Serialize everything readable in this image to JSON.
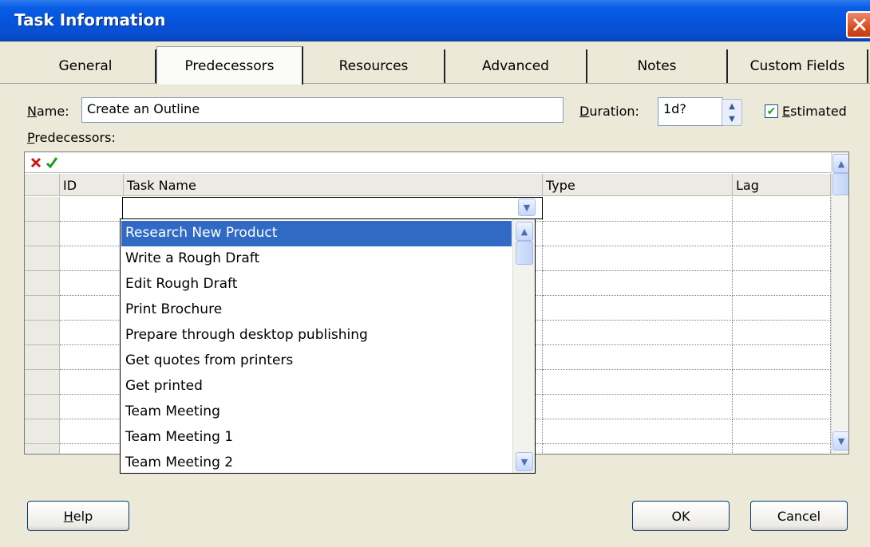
{
  "window": {
    "title": "Task Information"
  },
  "tabs": [
    {
      "label": "General"
    },
    {
      "label": "Predecessors"
    },
    {
      "label": "Resources"
    },
    {
      "label": "Advanced"
    },
    {
      "label": "Notes"
    },
    {
      "label": "Custom Fields"
    }
  ],
  "form": {
    "name_label": "ame:",
    "name_label_mnemonic": "N",
    "name_value": "Create an Outline",
    "duration_label": "uration:",
    "duration_label_mnemonic": "D",
    "duration_value": "1d?",
    "estimated_label": "stimated",
    "estimated_label_mnemonic": "E",
    "estimated_checked": true,
    "predecessors_label": "redecessors:",
    "predecessors_label_mnemonic": "P"
  },
  "grid": {
    "columns": [
      {
        "label": "ID"
      },
      {
        "label": "Task Name"
      },
      {
        "label": "Type"
      },
      {
        "label": "Lag"
      }
    ]
  },
  "dropdown": {
    "selected": "Research New Product",
    "items": [
      "Research New Product",
      "Write a Rough Draft",
      "Edit Rough Draft",
      "Print Brochure",
      "Prepare through desktop publishing",
      "Get quotes from printers",
      "Get printed",
      "Team Meeting",
      "Team Meeting 1",
      "Team Meeting 2"
    ]
  },
  "buttons": {
    "help": "elp",
    "help_mnemonic": "H",
    "ok": "OK",
    "cancel": "Cancel"
  },
  "icons": {
    "close": "close-icon",
    "cancel_entry": "red-x-icon",
    "accept_entry": "green-check-icon"
  },
  "colors": {
    "titlebar": "#0555dc",
    "selection": "#316ac5",
    "dialog_bg": "#ece9d8"
  }
}
